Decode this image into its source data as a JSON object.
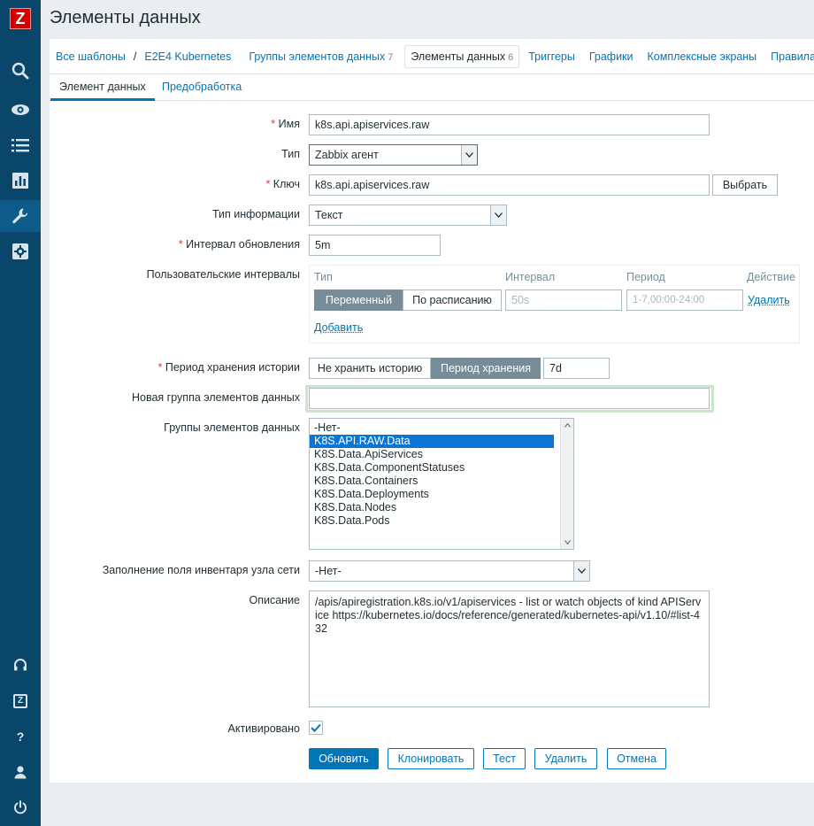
{
  "sidebar": {
    "logo": "Z",
    "icons": [
      "search-icon",
      "eye-icon",
      "list-icon",
      "chart-icon",
      "wrench-icon",
      "gear-icon"
    ],
    "bottom_icons": [
      "headset-icon",
      "share-z-icon",
      "help-icon",
      "user-icon",
      "power-icon"
    ],
    "share_label": "Z",
    "help_label": "?"
  },
  "page": {
    "title": "Элементы данных"
  },
  "nav": {
    "all_templates": "Все шаблоны",
    "separator": "/",
    "template": "E2E4 Kubernetes",
    "app_groups": "Группы элементов данных",
    "app_groups_count": "7",
    "items": "Элементы данных",
    "items_count": "6",
    "triggers": "Триггеры",
    "graphs": "Графики",
    "screens": "Комплексные экраны",
    "rules": "Правила о"
  },
  "tabs": {
    "item": "Элемент данных",
    "preprocessing": "Предобработка"
  },
  "form": {
    "required_mark": "*",
    "name_label": "Имя",
    "name_value": "k8s.api.apiservices.raw",
    "type_label": "Тип",
    "type_value": "Zabbix агент",
    "key_label": "Ключ",
    "key_value": "k8s.api.apiservices.raw",
    "select_button": "Выбрать",
    "info_type_label": "Тип информации",
    "info_type_value": "Текст",
    "interval_label": "Интервал обновления",
    "interval_value": "5m",
    "custom_intervals_label": "Пользовательские интервалы",
    "ci_col_type": "Тип",
    "ci_col_interval": "Интервал",
    "ci_col_period": "Период",
    "ci_col_action": "Действие",
    "ci_flexible": "Переменный",
    "ci_scheduling": "По расписанию",
    "ci_interval_placeholder": "50s",
    "ci_period_placeholder": "1-7,00:00-24:00",
    "ci_remove": "Удалить",
    "ci_add": "Добавить",
    "history_label": "Период хранения истории",
    "history_no": "Не хранить историю",
    "history_period": "Период хранения",
    "history_value": "7d",
    "new_app_label": "Новая группа элементов данных",
    "new_app_value": "",
    "apps_label": "Группы элементов данных",
    "apps_options": [
      "-Нет-",
      "K8S.API.RAW.Data",
      "K8S.Data.ApiServices",
      "K8S.Data.ComponentStatuses",
      "K8S.Data.Containers",
      "K8S.Data.Deployments",
      "K8S.Data.Nodes",
      "K8S.Data.Pods"
    ],
    "apps_selected": "K8S.API.RAW.Data",
    "inventory_label": "Заполнение поля инвентаря узла сети",
    "inventory_value": "-Нет-",
    "description_label": "Описание",
    "description_value": "/apis/apiregistration.k8s.io/v1/apiservices - list or watch objects of kind APIService https://kubernetes.io/docs/reference/generated/kubernetes-api/v1.10/#list-432",
    "enabled_label": "Активировано",
    "enabled": true
  },
  "actions": {
    "update": "Обновить",
    "clone": "Клонировать",
    "test": "Тест",
    "delete": "Удалить",
    "cancel": "Отмена"
  },
  "colors": {
    "sidebar": "#0a466a",
    "accent": "#0275b8",
    "required": "#e33734",
    "selected": "#0b75d5"
  }
}
